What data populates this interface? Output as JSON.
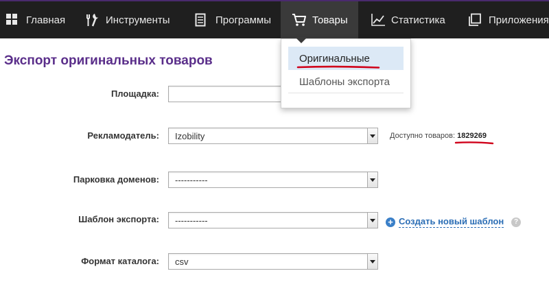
{
  "nav": {
    "items": [
      {
        "label": "Главная",
        "icon": "grid-icon"
      },
      {
        "label": "Инструменты",
        "icon": "tools-icon"
      },
      {
        "label": "Программы",
        "icon": "document-icon"
      },
      {
        "label": "Товары",
        "icon": "cart-icon"
      },
      {
        "label": "Статистика",
        "icon": "chart-icon"
      },
      {
        "label": "Приложения",
        "icon": "windows-icon"
      }
    ],
    "active": "Товары"
  },
  "dropdown": {
    "items": [
      {
        "label": "Оригинальные",
        "selected": true
      },
      {
        "label": "Шаблоны экспорта",
        "selected": false
      }
    ]
  },
  "page": {
    "title": "Экспорт оригинальных товаров"
  },
  "form": {
    "platform": {
      "label": "Площадка:",
      "value": ""
    },
    "advertiser": {
      "label": "Рекламодатель:",
      "value": "Izobility"
    },
    "parking": {
      "label": "Парковка доменов:",
      "value": "-----------"
    },
    "template": {
      "label": "Шаблон экспорта:",
      "value": "-----------"
    },
    "format": {
      "label": "Формат каталога:",
      "value": "csv"
    }
  },
  "available": {
    "label": "Доступно товаров:",
    "count": "1829269"
  },
  "create_template": {
    "label": "Создать новый шаблон"
  },
  "help": {
    "label": "?"
  },
  "colors": {
    "nav_bg": "#1f1f1f",
    "nav_active": "#3a3a3a",
    "title_purple": "#5a2e8a",
    "link_blue": "#2a6db5",
    "highlight_red": "#d0021b",
    "selected_bg": "#dce9f6"
  }
}
